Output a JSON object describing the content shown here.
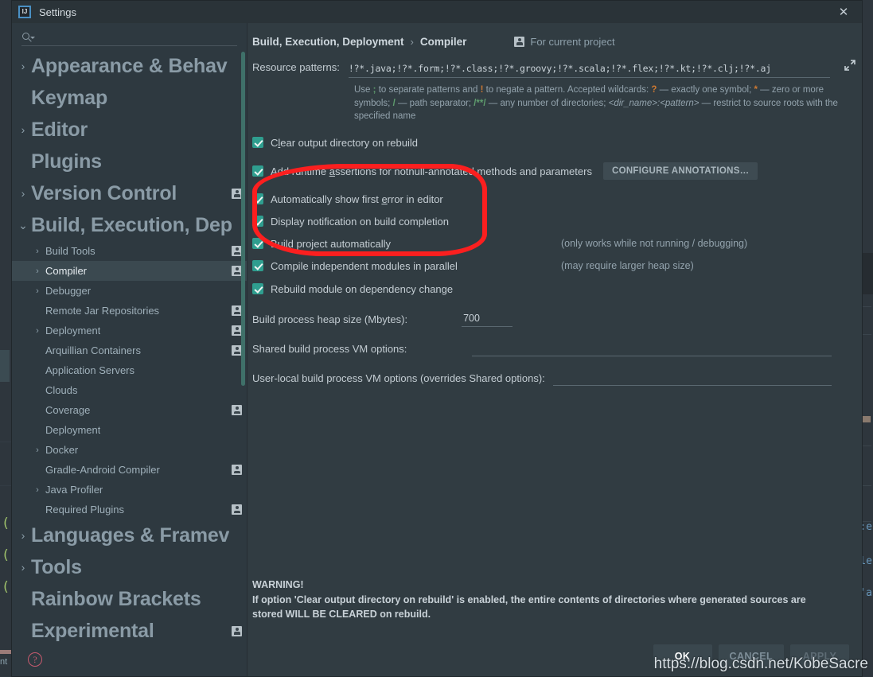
{
  "window": {
    "title": "Settings",
    "logo_text": "IJ",
    "close_label": "✕"
  },
  "sidebar": {
    "search": {
      "value": "",
      "placeholder": ""
    },
    "items": [
      {
        "label": "Appearance & Behav",
        "level": 0,
        "arrow": "›",
        "person": false,
        "selected": false
      },
      {
        "label": "Keymap",
        "level": 0,
        "arrow": "",
        "person": false,
        "selected": false
      },
      {
        "label": "Editor",
        "level": 0,
        "arrow": "›",
        "person": false,
        "selected": false
      },
      {
        "label": "Plugins",
        "level": 0,
        "arrow": "",
        "person": false,
        "selected": false
      },
      {
        "label": "Version Control",
        "level": 0,
        "arrow": "›",
        "person": true,
        "selected": false
      },
      {
        "label": "Build, Execution, Dep",
        "level": 0,
        "arrow": "⌄",
        "person": false,
        "selected": false
      },
      {
        "label": "Build Tools",
        "level": 1,
        "arrow": "›",
        "person": true,
        "selected": false
      },
      {
        "label": "Compiler",
        "level": 1,
        "arrow": "›",
        "person": true,
        "selected": true
      },
      {
        "label": "Debugger",
        "level": 1,
        "arrow": "›",
        "person": false,
        "selected": false
      },
      {
        "label": "Remote Jar Repositories",
        "level": 1,
        "arrow": "",
        "person": true,
        "selected": false
      },
      {
        "label": "Deployment",
        "level": 1,
        "arrow": "›",
        "person": true,
        "selected": false
      },
      {
        "label": "Arquillian Containers",
        "level": 1,
        "arrow": "",
        "person": true,
        "selected": false
      },
      {
        "label": "Application Servers",
        "level": 1,
        "arrow": "",
        "person": false,
        "selected": false
      },
      {
        "label": "Clouds",
        "level": 1,
        "arrow": "",
        "person": false,
        "selected": false
      },
      {
        "label": "Coverage",
        "level": 1,
        "arrow": "",
        "person": true,
        "selected": false
      },
      {
        "label": "Deployment",
        "level": 1,
        "arrow": "",
        "person": false,
        "selected": false
      },
      {
        "label": "Docker",
        "level": 1,
        "arrow": "›",
        "person": false,
        "selected": false
      },
      {
        "label": "Gradle-Android Compiler",
        "level": 1,
        "arrow": "",
        "person": true,
        "selected": false
      },
      {
        "label": "Java Profiler",
        "level": 1,
        "arrow": "›",
        "person": false,
        "selected": false
      },
      {
        "label": "Required Plugins",
        "level": 1,
        "arrow": "",
        "person": true,
        "selected": false
      },
      {
        "label": "Languages & Framev",
        "level": 0,
        "arrow": "›",
        "person": false,
        "selected": false
      },
      {
        "label": "Tools",
        "level": 0,
        "arrow": "›",
        "person": false,
        "selected": false
      },
      {
        "label": "Rainbow Brackets",
        "level": 0,
        "arrow": "",
        "person": false,
        "selected": false
      },
      {
        "label": "Experimental",
        "level": 0,
        "arrow": "",
        "person": true,
        "selected": false
      }
    ],
    "help_glyph": "?"
  },
  "main": {
    "breadcrumb_root": "Build, Execution, Deployment",
    "breadcrumb_sep": "›",
    "breadcrumb_leaf": "Compiler",
    "for_current_project": "For current project",
    "resource_patterns_label": "Resource patterns:",
    "resource_patterns_value": "!?*.java;!?*.form;!?*.class;!?*.groovy;!?*.scala;!?*.flex;!?*.kt;!?*.clj;!?*.aj",
    "hint": {
      "p1": "Use ",
      "semicolon": ";",
      "p2": " to separate patterns and ",
      "bang": "!",
      "p3": " to negate a pattern. Accepted wildcards: ",
      "question": "?",
      "p4": " — exactly one symbol; ",
      "star": "*",
      "p5": " — zero or more symbols; ",
      "slash": "/",
      "p6": " — path separator; ",
      "globstar": "/**/",
      "p7": " — any number of directories;  ",
      "dirpattern": "<dir_name>:<pattern>",
      "p8": " — restrict to source roots with the specified name"
    },
    "checkboxes": [
      {
        "pre": "C",
        "mnemonic": "l",
        "post": "ear output directory on rebuild",
        "checked": true
      },
      {
        "pre": "Add runtime ",
        "mnemonic": "a",
        "post": "ssertions for notnull-annotated methods and parameters",
        "checked": true
      },
      {
        "pre": "Automatically show first ",
        "mnemonic": "e",
        "post": "rror in editor",
        "checked": true
      },
      {
        "pre": "Display notification on build completion",
        "mnemonic": "",
        "post": "",
        "checked": true
      },
      {
        "pre": "Build project automatically",
        "mnemonic": "",
        "post": "",
        "checked": true
      },
      {
        "pre": "Compile independent modules in parallel",
        "mnemonic": "",
        "post": "",
        "checked": true
      },
      {
        "pre": "Rebuild module on dependency change",
        "mnemonic": "",
        "post": "",
        "checked": true
      }
    ],
    "configure_annotations_pre": "C",
    "configure_annotations_mn": "C",
    "configure_annotations_label": "CONFIGURE ANNOTATIONS…",
    "note_build_auto": "(only works while not running / debugging)",
    "note_parallel": "(may require larger heap size)",
    "heap_label": "Build process heap size (Mbytes):",
    "heap_value": "700",
    "shared_vm_label": "Shared build process VM options:",
    "shared_vm_value": "",
    "userlocal_vm_label": "User-local build process VM options (overrides Shared options):",
    "userlocal_vm_value": "",
    "warning_title": "WARNING!",
    "warning_body": "If option 'Clear output directory on rebuild' is enabled, the entire contents of directories where generated sources are stored WILL BE CLEARED on rebuild."
  },
  "footer": {
    "ok": "OK",
    "cancel": "CANCEL",
    "apply": "APPLY"
  },
  "watermark": "https://blog.csdn.net/KobeSacre",
  "colors": {
    "accent_teal": "#2f9e8f",
    "annotation_red": "#fb1f1f",
    "dialog_bg": "#313c42",
    "sidebar_bg": "#2e3940",
    "selected_row": "#3b4950"
  },
  "background": {
    "bottom_text": "nt"
  }
}
